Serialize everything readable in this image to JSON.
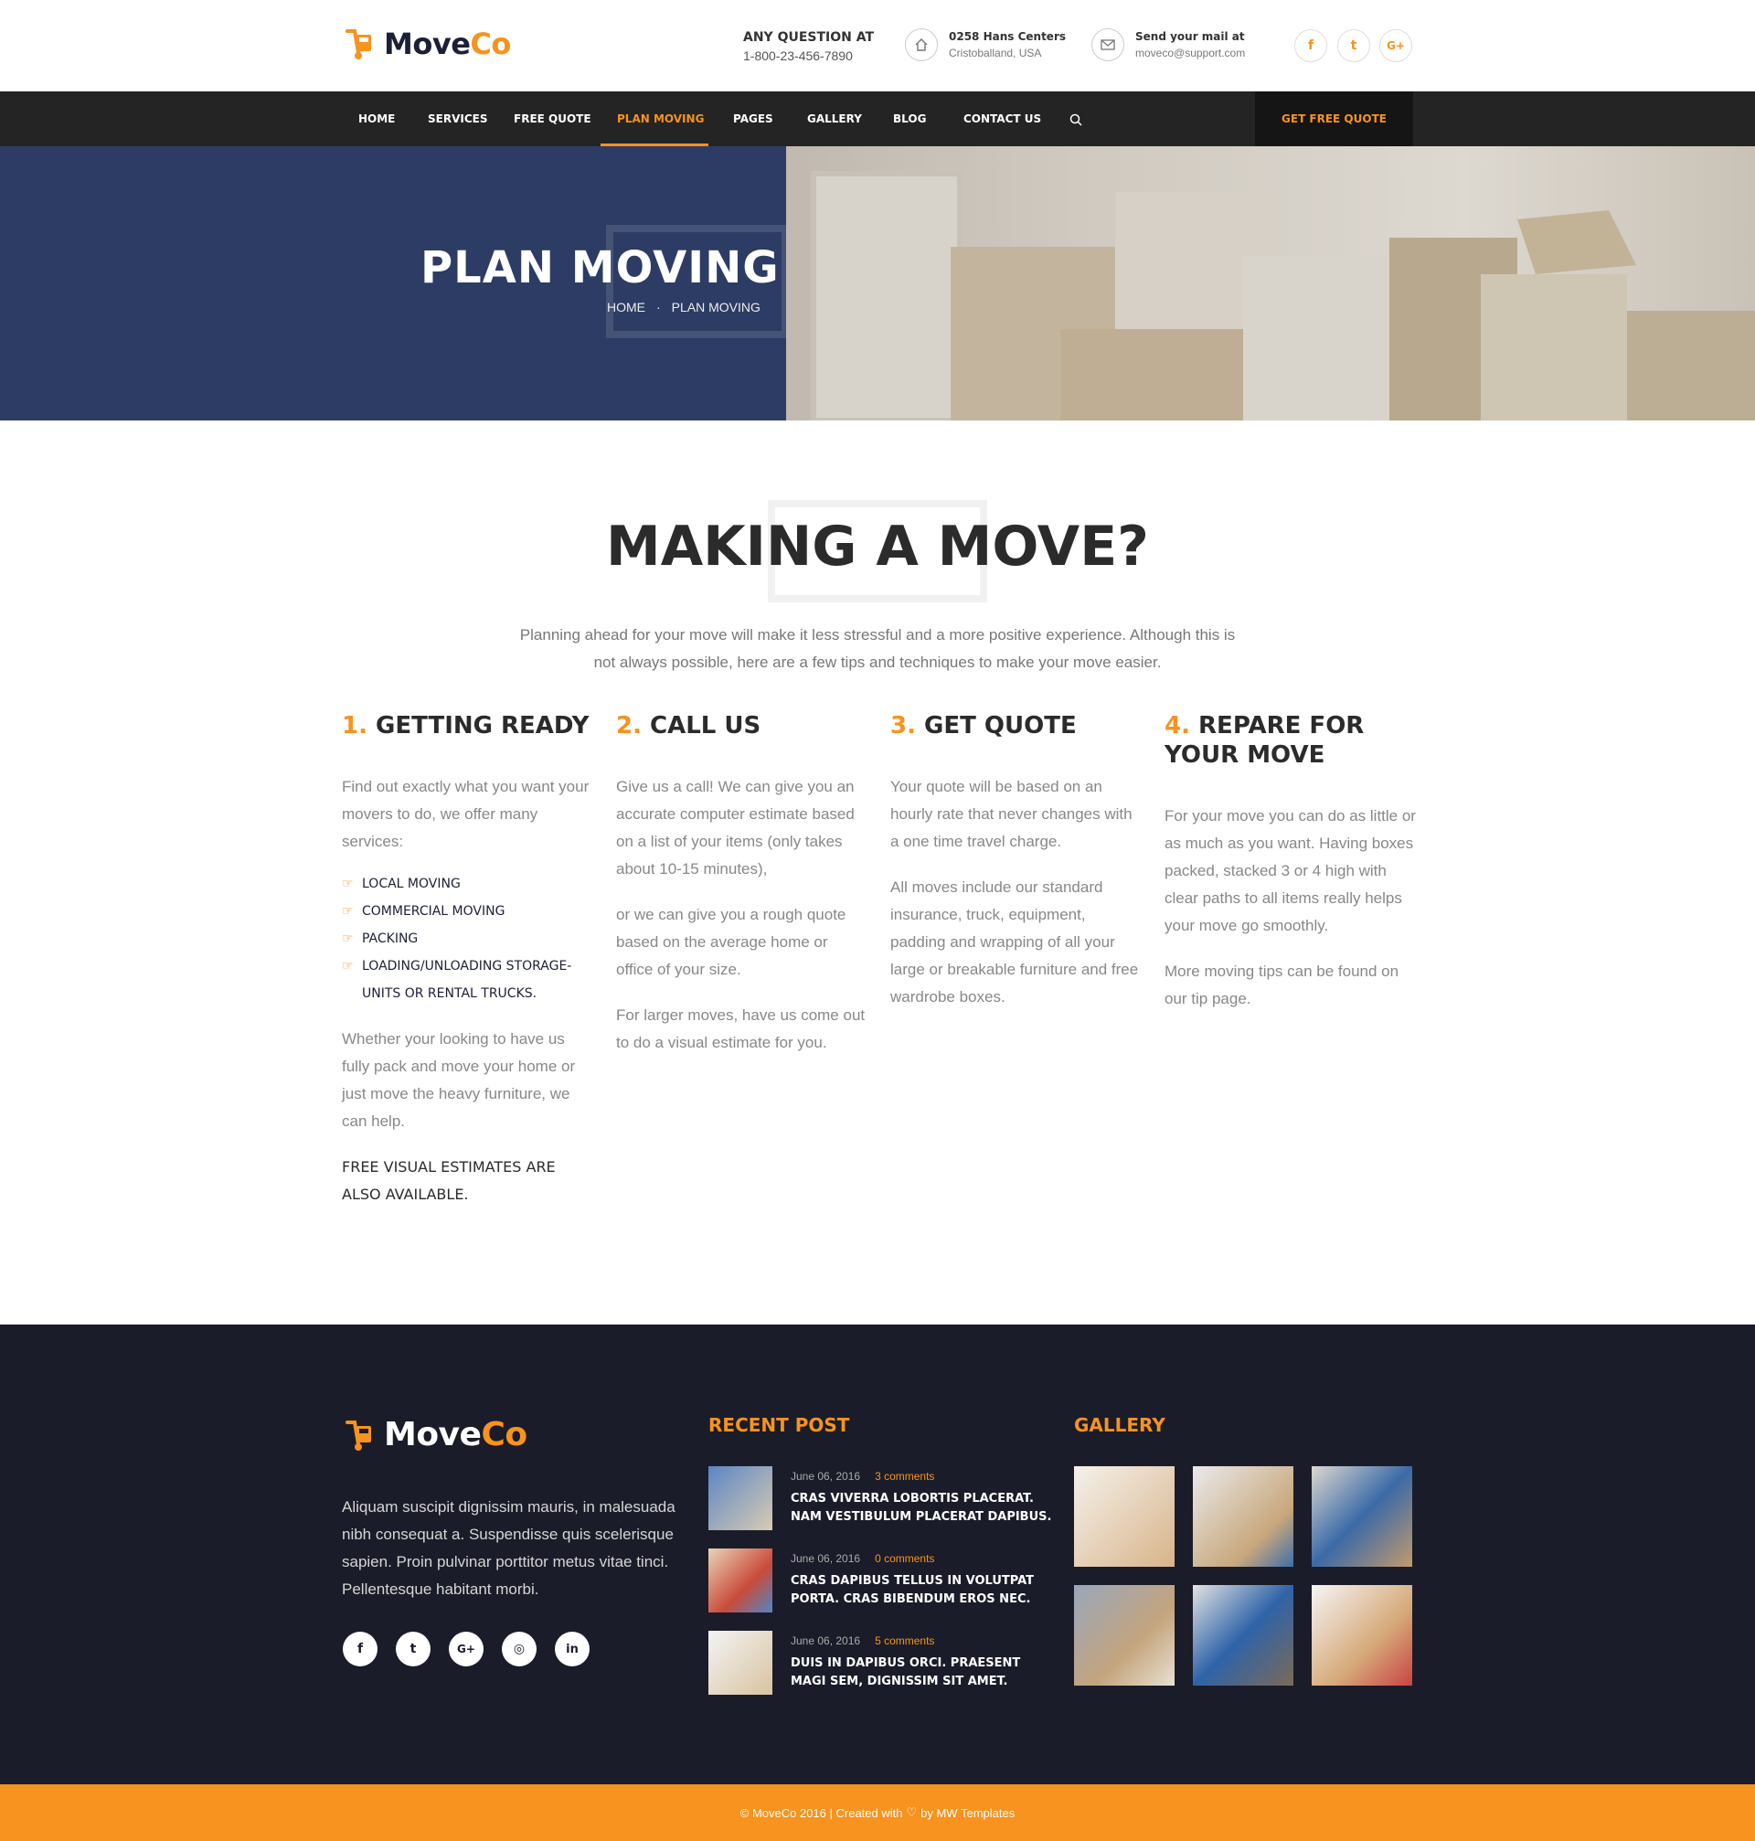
{
  "brand": {
    "name_a": "Move",
    "name_b": "Co"
  },
  "header": {
    "question_title": "ANY QUESTION AT",
    "question_phone": "1-800-23-456-7890",
    "address_title": "0258 Hans Centers",
    "address_line": "Cristoballand, USA",
    "mail_title": "Send your mail at",
    "mail_value": "moveco@support.com",
    "social": [
      {
        "icon": "facebook-icon",
        "glyph": "f"
      },
      {
        "icon": "twitter-icon",
        "glyph": "t"
      },
      {
        "icon": "google-plus-icon",
        "glyph": "G+"
      }
    ]
  },
  "nav": {
    "items": [
      "HOME",
      "SERVICES",
      "FREE QUOTE",
      "PLAN MOVING",
      "PAGES",
      "GALLERY",
      "BLOG",
      "CONTACT US"
    ],
    "active": "PLAN MOVING",
    "cta": "GET FREE QUOTE"
  },
  "hero": {
    "title": "PLAN MOVING",
    "breadcrumb": [
      "HOME",
      "·",
      "PLAN MOVING"
    ]
  },
  "main": {
    "heading": "MAKING A MOVE?",
    "lead": "Planning ahead for your move will make it less stressful and a more positive experience. Although this is not always possible, here are a few tips and techniques to make your move easier.",
    "columns": [
      {
        "num": "1.",
        "title": "GETTING READY",
        "p1": "Find out exactly what you want your movers to do, we offer many services:",
        "list": [
          "LOCAL MOVING",
          "COMMERCIAL MOVING",
          "PACKING",
          "LOADING/UNLOADING STORAGE-UNITS OR RENTAL TRUCKS."
        ],
        "p2": "Whether your looking to have us fully pack and move your home or just move the heavy furniture, we can help.",
        "strong": "FREE VISUAL ESTIMATES ARE ALSO AVAILABLE."
      },
      {
        "num": "2.",
        "title": "CALL US",
        "p1": "Give us a call! We can give you an accurate computer estimate based on a list of your items (only takes about 10-15 minutes),",
        "p2": "or we can give you a rough quote based on the average home or office of your size.",
        "p3": "For larger moves, have us come out to do a visual estimate for you."
      },
      {
        "num": "3.",
        "title": "GET QUOTE",
        "p1": "Your quote will be based on an hourly rate that never changes with a one time travel charge.",
        "p2": "All moves include our standard insurance, truck, equipment, padding and wrapping of all your large or breakable furniture and free wardrobe boxes."
      },
      {
        "num": "4.",
        "title": "REPARE FOR YOUR MOVE",
        "p1": "For your move you can do as little or as much as you want. Having boxes packed, stacked 3 or 4 high with clear paths to all items really helps your move go smoothly.",
        "p2": "More moving tips can be found on our tip page."
      }
    ]
  },
  "footer": {
    "about": "Aliquam suscipit dignissim mauris, in malesuada nibh consequat a. Suspendisse quis scelerisque sapien. Proin pulvinar porttitor metus vitae tinci. Pellentesque habitant morbi.",
    "social": [
      {
        "icon": "facebook-icon",
        "glyph": "f"
      },
      {
        "icon": "twitter-icon",
        "glyph": "t"
      },
      {
        "icon": "google-plus-icon",
        "glyph": "G+"
      },
      {
        "icon": "instagram-icon",
        "glyph": "◎"
      },
      {
        "icon": "linkedin-icon",
        "glyph": "in"
      }
    ],
    "recent_title": "RECENT POST",
    "posts": [
      {
        "date": "June 06, 2016",
        "comments": "3 comments",
        "title": "CRAS VIVERRA LOBORTIS PLACERAT. NAM VESTIBULUM PLACERAT DAPIBUS."
      },
      {
        "date": "June 06, 2016",
        "comments": "0 comments",
        "title": "CRAS DAPIBUS TELLUS IN VOLUTPAT PORTA. CRAS BIBENDUM EROS NEC."
      },
      {
        "date": "June 06, 2016",
        "comments": "5 comments",
        "title": "DUIS IN DAPIBUS ORCI. PRAESENT MAGI SEM, DIGNISSIM SIT AMET."
      }
    ],
    "gallery_title": "GALLERY",
    "copyright_a": "© MoveCo 2016 | Created with",
    "copyright_b": "by MW Templates"
  },
  "colors": {
    "accent": "#f7931e",
    "nav_bg": "#242424",
    "footer_bg": "#1b1c29",
    "dark_text": "#2b2b2b"
  }
}
